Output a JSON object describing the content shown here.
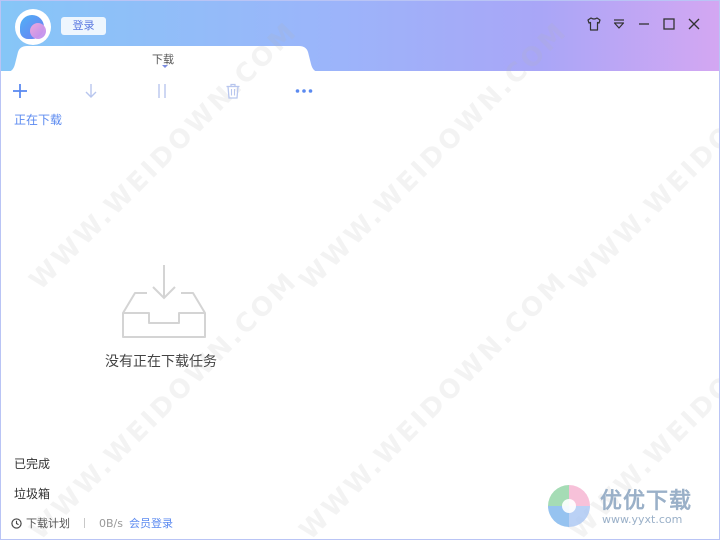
{
  "header": {
    "login_label": "登录"
  },
  "tabs": [
    {
      "label": "下载"
    }
  ],
  "toolbar": {
    "items": [
      "add-icon",
      "download-arrow-icon",
      "pause-icon",
      "delete-icon",
      "more-icon"
    ]
  },
  "sidebar": {
    "downloading_label": "正在下载",
    "completed_label": "已完成",
    "trash_label": "垃圾箱"
  },
  "main": {
    "empty_message": "没有正在下载任务"
  },
  "statusbar": {
    "schedule_label": "下载计划",
    "speed": "0B/s",
    "vip_login_label": "会员登录"
  },
  "watermark": {
    "text": "WWW.WEIDOWN.COM"
  },
  "brand": {
    "name": "优优下载",
    "url": "www.yyxt.com"
  },
  "colors": {
    "accent": "#5b8af0",
    "title_gradient_start": "#86c6f7",
    "title_gradient_end": "#d4a7f2"
  }
}
